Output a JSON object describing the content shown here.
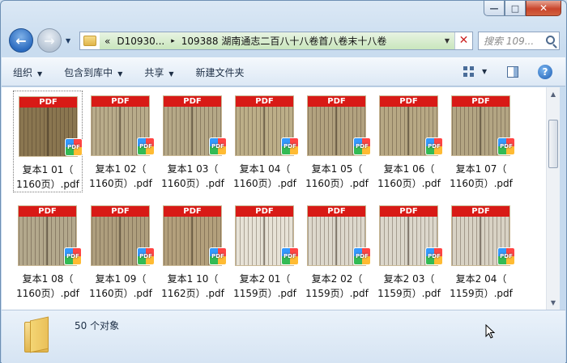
{
  "window": {
    "caption_min": "—",
    "caption_max": "□",
    "caption_close": "✕"
  },
  "nav": {
    "back": "←",
    "forward": "→"
  },
  "address": {
    "chevron": "«",
    "segment_1": "D10930...",
    "segment_2": "109388 湖南通志二百八十八卷首八卷末十八卷",
    "separator": "▸"
  },
  "search": {
    "placeholder": "搜索 109..."
  },
  "toolbar": {
    "organize": "组织",
    "include_library": "包含到库中",
    "share": "共享",
    "new_folder": "新建文件夹"
  },
  "thumb_bar_label": "PDF",
  "badge_label": "PDF",
  "files": [
    {
      "line1": "复本1 01（",
      "line2": "1160页）.pdf",
      "tone": "#8a7650",
      "selected": true
    },
    {
      "line1": "复本1 02（",
      "line2": "1160页）.pdf",
      "tone": "#b8ab8a"
    },
    {
      "line1": "复本1 03（",
      "line2": "1160页）.pdf",
      "tone": "#b5a887"
    },
    {
      "line1": "复本1 04（",
      "line2": "1160页）.pdf",
      "tone": "#bcae88"
    },
    {
      "line1": "复本1 05（",
      "line2": "1160页）.pdf",
      "tone": "#b2a27f"
    },
    {
      "line1": "复本1 06（",
      "line2": "1160页）.pdf",
      "tone": "#b7a884"
    },
    {
      "line1": "复本1 07（",
      "line2": "1160页）.pdf",
      "tone": "#b3a583"
    },
    {
      "line1": "复本1 08（",
      "line2": "1160页）.pdf",
      "tone": "#b3a88c"
    },
    {
      "line1": "复本1 09（",
      "line2": "1160页）.pdf",
      "tone": "#ae9e7d"
    },
    {
      "line1": "复本1 10（",
      "line2": "1162页）.pdf",
      "tone": "#b3a07c"
    },
    {
      "line1": "复本2 01（",
      "line2": "1159页）.pdf",
      "tone": "#e7e2d6"
    },
    {
      "line1": "复本2 02（",
      "line2": "1159页）.pdf",
      "tone": "#ddd8cc"
    },
    {
      "line1": "复本2 03（",
      "line2": "1159页）.pdf",
      "tone": "#dcd7cb"
    },
    {
      "line1": "复本2 04（",
      "line2": "1159页）.pdf",
      "tone": "#d8d2c4"
    }
  ],
  "status": {
    "count": "50 个对象"
  }
}
